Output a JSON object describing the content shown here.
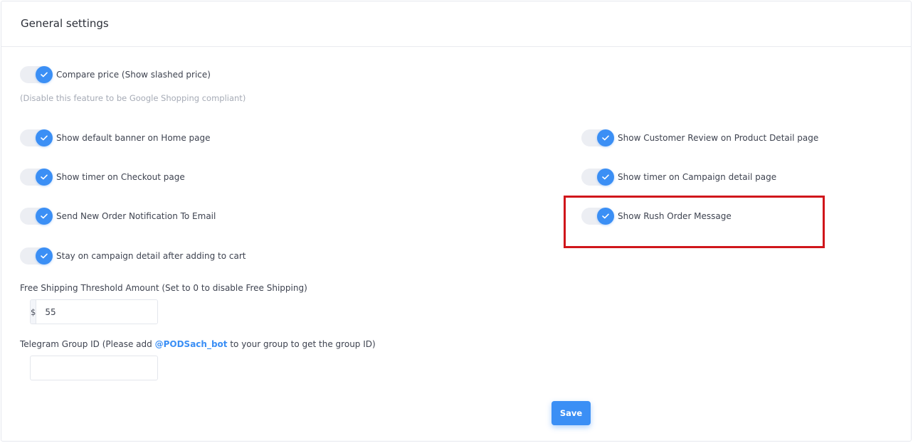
{
  "header": {
    "title": "General settings"
  },
  "toggles": {
    "compare_price": {
      "label": "Compare price (Show slashed price)",
      "checked": true
    },
    "default_banner": {
      "label": "Show default banner on Home page",
      "checked": true
    },
    "customer_review": {
      "label": "Show Customer Review on Product Detail page",
      "checked": true
    },
    "timer_checkout": {
      "label": "Show timer on Checkout page",
      "checked": true
    },
    "timer_campaign": {
      "label": "Show timer on Campaign detail page",
      "checked": true
    },
    "order_notification": {
      "label": "Send New Order Notification To Email",
      "checked": true
    },
    "rush_order": {
      "label": "Show Rush Order Message",
      "checked": true
    },
    "stay_on_campaign": {
      "label": "Stay on campaign detail after adding to cart",
      "checked": true
    }
  },
  "hints": {
    "compare_price_note": "(Disable this feature to be Google Shopping compliant)"
  },
  "free_shipping": {
    "label": "Free Shipping Threshold Amount (Set to 0 to disable Free Shipping)",
    "currency": "$",
    "value": "55"
  },
  "telegram": {
    "label_before": "Telegram Group ID (Please add ",
    "bot_name": "@PODSach_bot",
    "label_after": " to your group to get the group ID)",
    "value": ""
  },
  "actions": {
    "save_label": "Save"
  },
  "colors": {
    "accent": "#3b8ff5",
    "highlight": "#d0161b"
  }
}
